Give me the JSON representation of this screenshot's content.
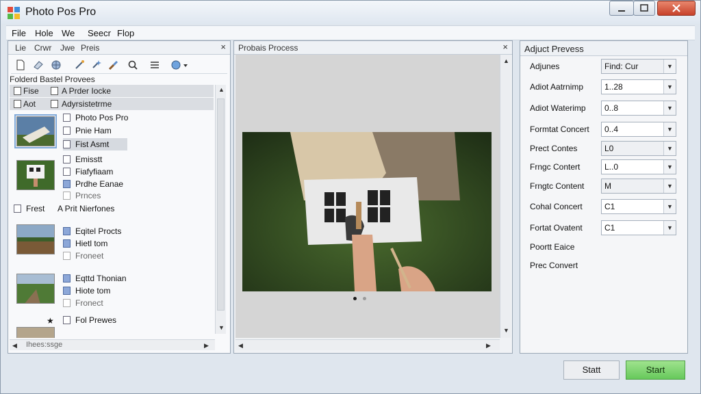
{
  "window": {
    "title": "Photo Pos Pro"
  },
  "menu": [
    "File",
    "Hole",
    "We",
    "Seecr",
    "Flop"
  ],
  "left_panel": {
    "tabs": [
      "Lie",
      "Crwr",
      "Jwe",
      "Preis"
    ],
    "close_glyph": "×",
    "breadcrumb": "Folderd Bastel Provees",
    "header_rows": [
      {
        "left": "Fise",
        "right": "A Prder Iocke"
      },
      {
        "left": "Aot",
        "right": "Adyrsistetrme"
      }
    ],
    "groups": [
      {
        "files": [
          {
            "name": "Photo Pos Pro",
            "icon": "white"
          },
          {
            "name": "Pnie Ham",
            "icon": "white"
          },
          {
            "name": "Fist Asmt",
            "icon": "white",
            "highlight": true
          }
        ]
      },
      {
        "files": [
          {
            "name": "Emisstt",
            "icon": "white"
          },
          {
            "name": "Fiafyfiaam",
            "icon": "white"
          },
          {
            "name": "Prdhe Eanae",
            "icon": "blue"
          },
          {
            "name": "Prnces",
            "icon": "white",
            "faint": true
          }
        ]
      },
      {
        "files": [
          {
            "name": "Eqitel Procts",
            "icon": "blue"
          },
          {
            "name": "Hietl tom",
            "icon": "blue"
          },
          {
            "name": "Froneet",
            "icon": "white",
            "faint": true
          }
        ]
      },
      {
        "files": [
          {
            "name": "Eqttd Thonian",
            "icon": "blue"
          },
          {
            "name": "Hiote tom",
            "icon": "blue"
          },
          {
            "name": "Fronect",
            "icon": "white",
            "faint": true
          }
        ]
      },
      {
        "files": [
          {
            "name": "Fol Prewes",
            "icon": "white"
          }
        ]
      }
    ],
    "section_row": {
      "left": "Frest",
      "right": "A Prit Nierfones"
    },
    "hscroll_label": "Ihees:ssge"
  },
  "center_panel": {
    "title": "Probais Process",
    "close_glyph": "×"
  },
  "right_panel": {
    "title": "Adjuct Prevess",
    "rows": [
      {
        "label": "Adjunes",
        "value": "Find: Cur",
        "flat": true
      },
      {
        "label": "Adiot Aatrnimp",
        "value": "1..28"
      },
      {
        "label": "Adiot Waterimp",
        "value": "0..8"
      },
      {
        "label": "Formtat Concert",
        "value": "0..4"
      },
      {
        "label": "Prect Contes",
        "value": "L0",
        "flat": true
      },
      {
        "label": "Frngc Contert",
        "value": "L..0"
      },
      {
        "label": "Frngtc Content",
        "value": "M",
        "flat": true
      },
      {
        "label": "Cohal Concert",
        "value": "C1"
      },
      {
        "label": "Fortat Ovatent",
        "value": "C1"
      }
    ],
    "extra_labels": [
      "Poortt Eaice",
      "Prec Convert"
    ]
  },
  "footer": {
    "secondary_button": "Statt",
    "primary_button": "Start"
  },
  "colors": {
    "primary_button": "#67c95b",
    "selection": "#dadde2",
    "blue_file_icon": "#8ca7d8"
  }
}
